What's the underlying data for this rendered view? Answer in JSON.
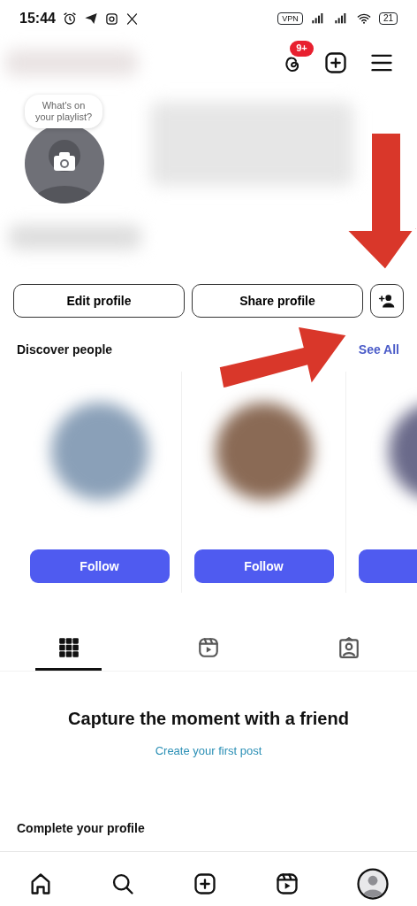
{
  "status_bar": {
    "time": "15:44",
    "vpn": "VPN",
    "battery": "21"
  },
  "header": {
    "notification_badge": "9+"
  },
  "profile": {
    "note": "What's on your playlist?"
  },
  "actions": [
    "Edit profile",
    "Share profile"
  ],
  "discover": {
    "title": "Discover people",
    "see_all": "See All",
    "cards": [
      {
        "kind": "full",
        "button": "Follow"
      },
      {
        "kind": "full",
        "button": "Follow"
      },
      {
        "kind": "partial"
      }
    ]
  },
  "tabs": [
    {
      "kind": "grid",
      "selected": true
    },
    {
      "kind": "reels",
      "selected": false
    },
    {
      "kind": "tagged",
      "selected": false
    }
  ],
  "empty_state": {
    "title": "Capture the moment with a friend",
    "link": "Create your first post"
  },
  "complete_profile": {
    "title": "Complete your profile"
  },
  "bottom_nav": [
    {
      "kind": "home"
    },
    {
      "kind": "search"
    },
    {
      "kind": "create"
    },
    {
      "kind": "reels"
    },
    {
      "kind": "profile"
    }
  ]
}
